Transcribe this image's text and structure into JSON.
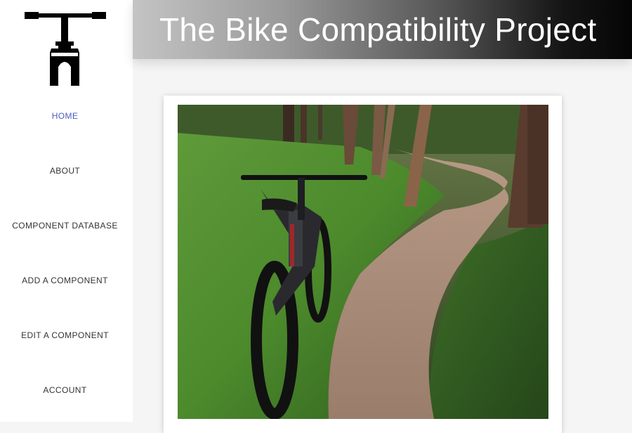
{
  "brand": {
    "logo_icon": "bicycle-handlebar-stem-icon"
  },
  "header": {
    "title": "The Bike Compatibility Project"
  },
  "nav": {
    "items": [
      {
        "label": "HOME",
        "active": true
      },
      {
        "label": "ABOUT",
        "active": false
      },
      {
        "label": "COMPONENT DATABASE",
        "active": false
      },
      {
        "label": "ADD A COMPONENT",
        "active": false
      },
      {
        "label": "EDIT A COMPONENT",
        "active": false
      },
      {
        "label": "ACCOUNT",
        "active": false
      }
    ]
  },
  "colors": {
    "active_nav": "#4a5dc0",
    "nav_text": "#333333",
    "header_gradient_start": "#c4c4c4",
    "header_gradient_end": "#050505"
  }
}
